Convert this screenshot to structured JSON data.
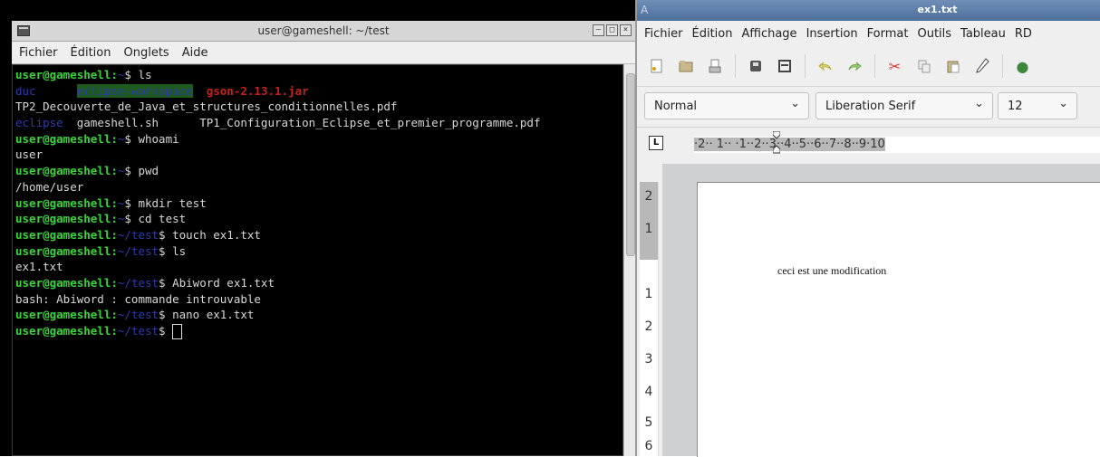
{
  "terminal": {
    "title": "user@gameshell: ~/test",
    "menu": [
      "Fichier",
      "Édition",
      "Onglets",
      "Aide"
    ],
    "lines": [
      [
        [
          "u",
          "user@gameshell:"
        ],
        [
          "p",
          "~"
        ],
        [
          "t",
          "$ ls"
        ]
      ],
      [
        [
          "d",
          "duc"
        ],
        [
          "t",
          "      "
        ],
        [
          "ew",
          "eclipse-workspace"
        ],
        [
          "t",
          "  "
        ],
        [
          "j",
          "gson-2.13.1.jar"
        ]
      ],
      [
        [
          "t",
          "TP2_Decouverte_de_Java_et_structures_conditionnelles.pdf"
        ]
      ],
      [
        [
          "d",
          "eclipse"
        ],
        [
          "t",
          "  gameshell.sh      TP1_Configuration_Eclipse_et_premier_programme.pdf"
        ]
      ],
      [
        [
          "u",
          "user@gameshell:"
        ],
        [
          "p",
          "~"
        ],
        [
          "t",
          "$ whoami"
        ]
      ],
      [
        [
          "t",
          "user"
        ]
      ],
      [
        [
          "u",
          "user@gameshell:"
        ],
        [
          "p",
          "~"
        ],
        [
          "t",
          "$ pwd"
        ]
      ],
      [
        [
          "t",
          "/home/user"
        ]
      ],
      [
        [
          "u",
          "user@gameshell:"
        ],
        [
          "p",
          "~"
        ],
        [
          "t",
          "$ mkdir test"
        ]
      ],
      [
        [
          "u",
          "user@gameshell:"
        ],
        [
          "p",
          "~"
        ],
        [
          "t",
          "$ cd test"
        ]
      ],
      [
        [
          "u",
          "user@gameshell:"
        ],
        [
          "p",
          "~/test"
        ],
        [
          "t",
          "$ touch ex1.txt"
        ]
      ],
      [
        [
          "u",
          "user@gameshell:"
        ],
        [
          "p",
          "~/test"
        ],
        [
          "t",
          "$ ls"
        ]
      ],
      [
        [
          "t",
          "ex1.txt"
        ]
      ],
      [
        [
          "u",
          "user@gameshell:"
        ],
        [
          "p",
          "~/test"
        ],
        [
          "t",
          "$ Abiword ex1.txt"
        ]
      ],
      [
        [
          "t",
          "bash: Abiword : commande introuvable"
        ]
      ],
      [
        [
          "u",
          "user@gameshell:"
        ],
        [
          "p",
          "~/test"
        ],
        [
          "t",
          "$ nano ex1.txt"
        ]
      ],
      [
        [
          "u",
          "user@gameshell:"
        ],
        [
          "p",
          "~/test"
        ],
        [
          "t",
          "$ "
        ],
        [
          "c",
          ""
        ]
      ]
    ]
  },
  "abiword": {
    "title": "ex1.txt",
    "menu": [
      "Fichier",
      "Édition",
      "Affichage",
      "Insertion",
      "Format",
      "Outils",
      "Tableau",
      "RD"
    ],
    "toolbar_icons": [
      "new-icon",
      "open-icon",
      "save-as-icon",
      "sep",
      "print-icon",
      "print-preview-icon",
      "sep",
      "undo-icon",
      "redo-icon",
      "sep",
      "cut-icon",
      "copy-icon",
      "paste-icon",
      "format-painter-icon",
      "sep",
      "link-icon"
    ],
    "style_value": "Normal",
    "font_value": "Liberation Serif",
    "size_value": "12",
    "ruler_corner": "L",
    "hruler_marks": "·2·· 1·· ·1··2··3··4··5··6··7··8··9·10",
    "vruler_numbers": [
      "2",
      "1",
      "1",
      "2",
      "3",
      "4",
      "5",
      "6"
    ],
    "document_text": "ceci est une modification"
  }
}
